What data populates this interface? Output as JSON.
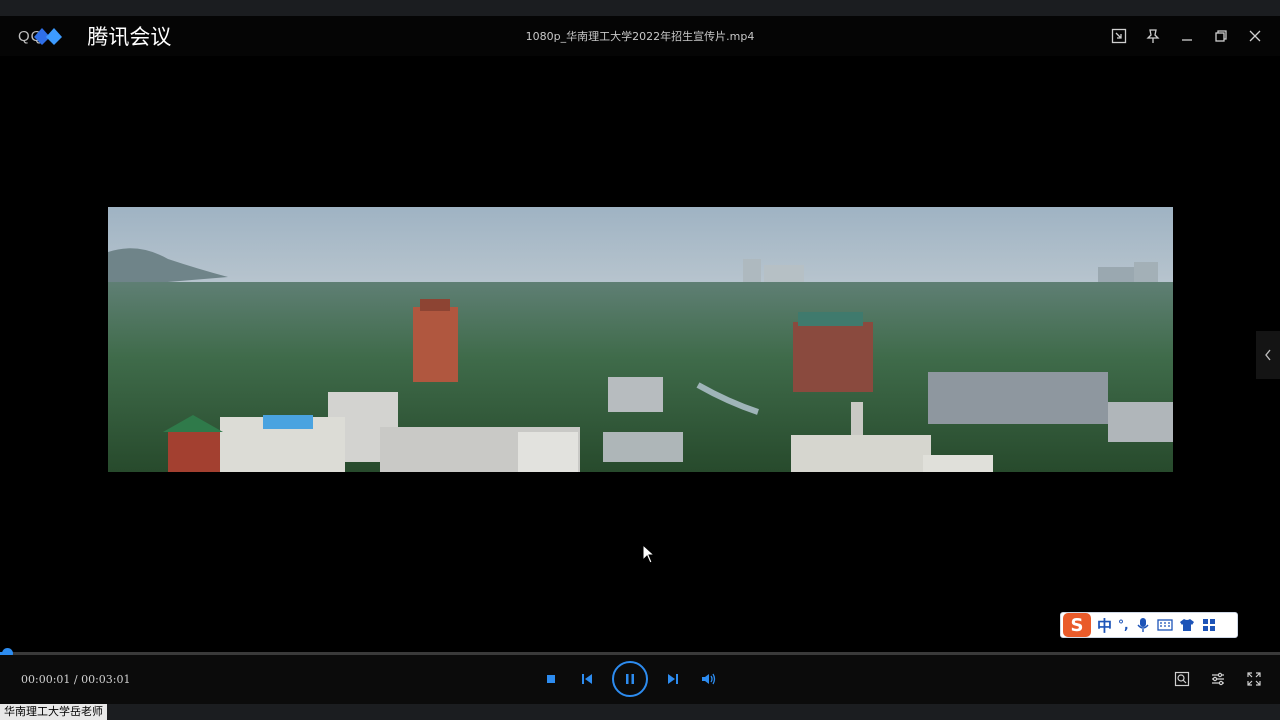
{
  "app": {
    "logo_prefix": "QQ",
    "brand": "腾讯会议"
  },
  "window": {
    "title": "1080p_华南理工大学2022年招生宣传片.mp4",
    "controls": [
      "picture-in-picture-icon",
      "pin-icon",
      "minimize-icon",
      "restore-icon",
      "close-icon"
    ]
  },
  "player": {
    "time_display": "00:00:01 / 00:03:01",
    "progress_fraction": 0.0055,
    "state": "playing",
    "accent": "#2d8cf0"
  },
  "ime": {
    "logo": "S",
    "mode": "中",
    "punct": "°,",
    "icons": [
      "microphone-icon",
      "keyboard-icon",
      "skin-icon",
      "toolbox-icon"
    ]
  },
  "caption": {
    "text": "华南理工大学岳老师"
  }
}
